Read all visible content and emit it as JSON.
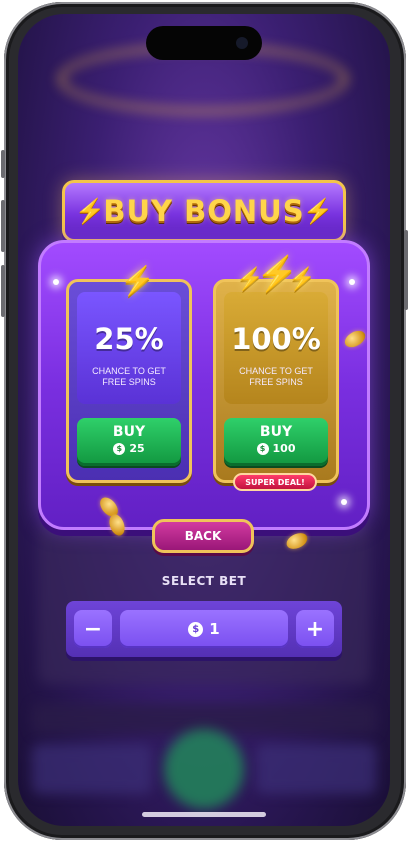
{
  "header": {
    "title": "BUY BONUS"
  },
  "options": [
    {
      "percent": "25%",
      "line1": "CHANCE TO GET",
      "line2": "FREE SPINS",
      "buy_label": "BUY",
      "price": "25"
    },
    {
      "percent": "100%",
      "line1": "CHANCE TO GET",
      "line2": "FREE SPINS",
      "buy_label": "BUY",
      "price": "100",
      "badge": "SUPER DEAL!"
    }
  ],
  "back_label": "BACK",
  "bet": {
    "label": "SELECT BET",
    "value": "1",
    "decrease": "−",
    "increase": "+"
  },
  "icons": {
    "coin": "$",
    "bolt": "⚡"
  },
  "colors": {
    "accent_gold": "#f0c35a",
    "panel_purple": "#7a2fe0",
    "buy_green": "#11963f",
    "back_magenta": "#9a1778"
  }
}
